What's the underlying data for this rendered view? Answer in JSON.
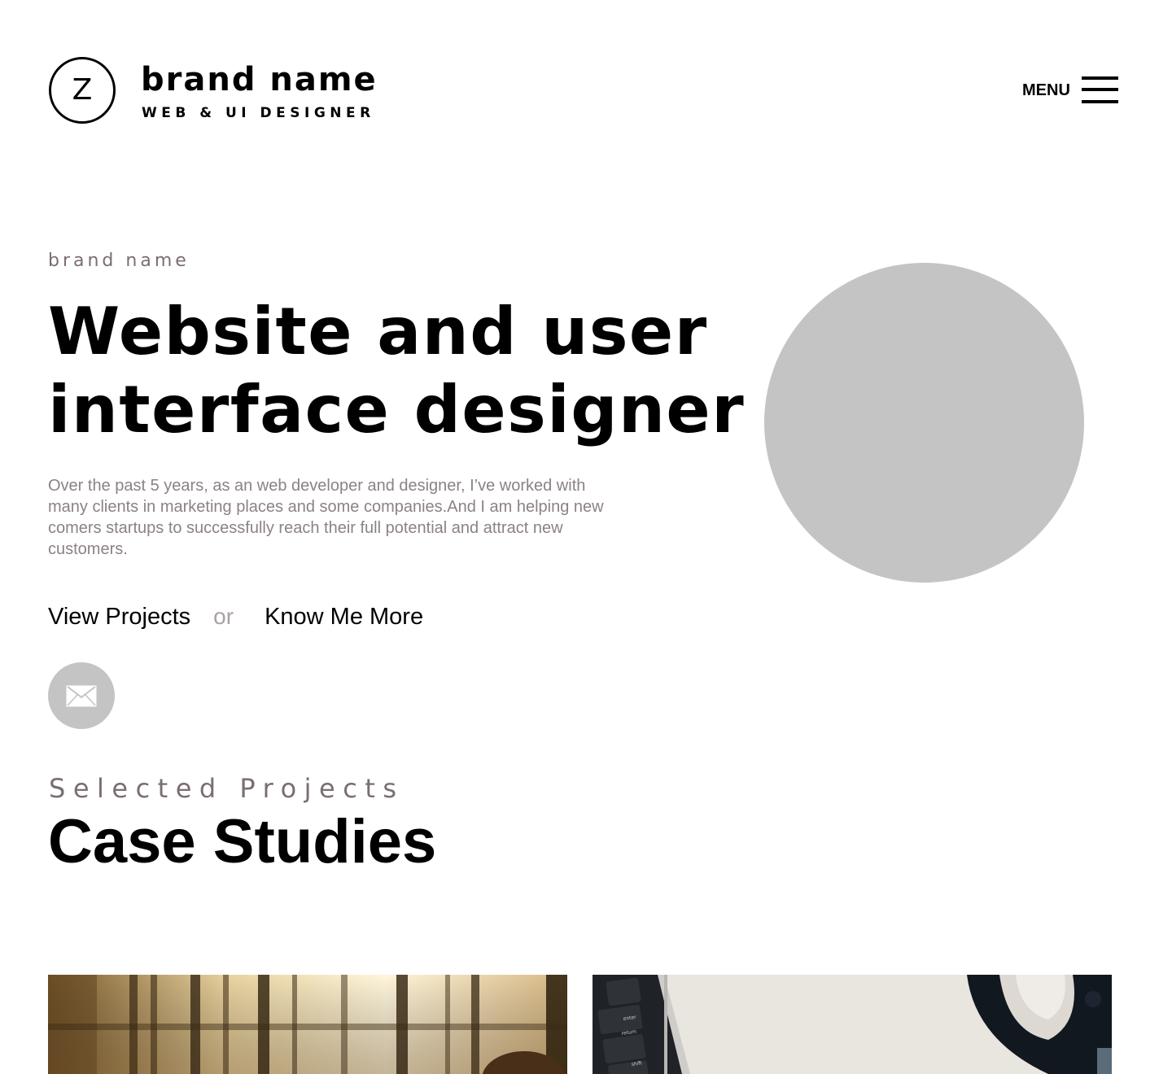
{
  "header": {
    "logo_letter": "Z",
    "brand_name": "brand name",
    "tagline": "WEB & UI DESIGNER",
    "menu_label": "MENU"
  },
  "hero": {
    "eyebrow": "brand name",
    "title_line1": "Website and user",
    "title_line2": "interface designer",
    "description": "Over the past 5 years, as an web developer and designer, I’ve worked with many clients in marketing places and some companies.And I am helping new comers startups to successfully reach their full potential and attract new customers.",
    "cta_primary": "View Projects",
    "cta_separator": "or",
    "cta_secondary": "Know Me More"
  },
  "case_studies": {
    "eyebrow": "Selected Projects",
    "title": "Case Studies",
    "keyboard_keys": [
      "enter",
      "return",
      "shift"
    ]
  },
  "colors": {
    "text": "#000000",
    "muted": "#8c8283",
    "eyebrow": "#7a6e70",
    "placeholder_gray": "#c4c4c4",
    "background": "#ffffff"
  },
  "icons": {
    "logo": "letter-z-circle",
    "menu": "hamburger-icon",
    "contact": "mail-icon"
  }
}
